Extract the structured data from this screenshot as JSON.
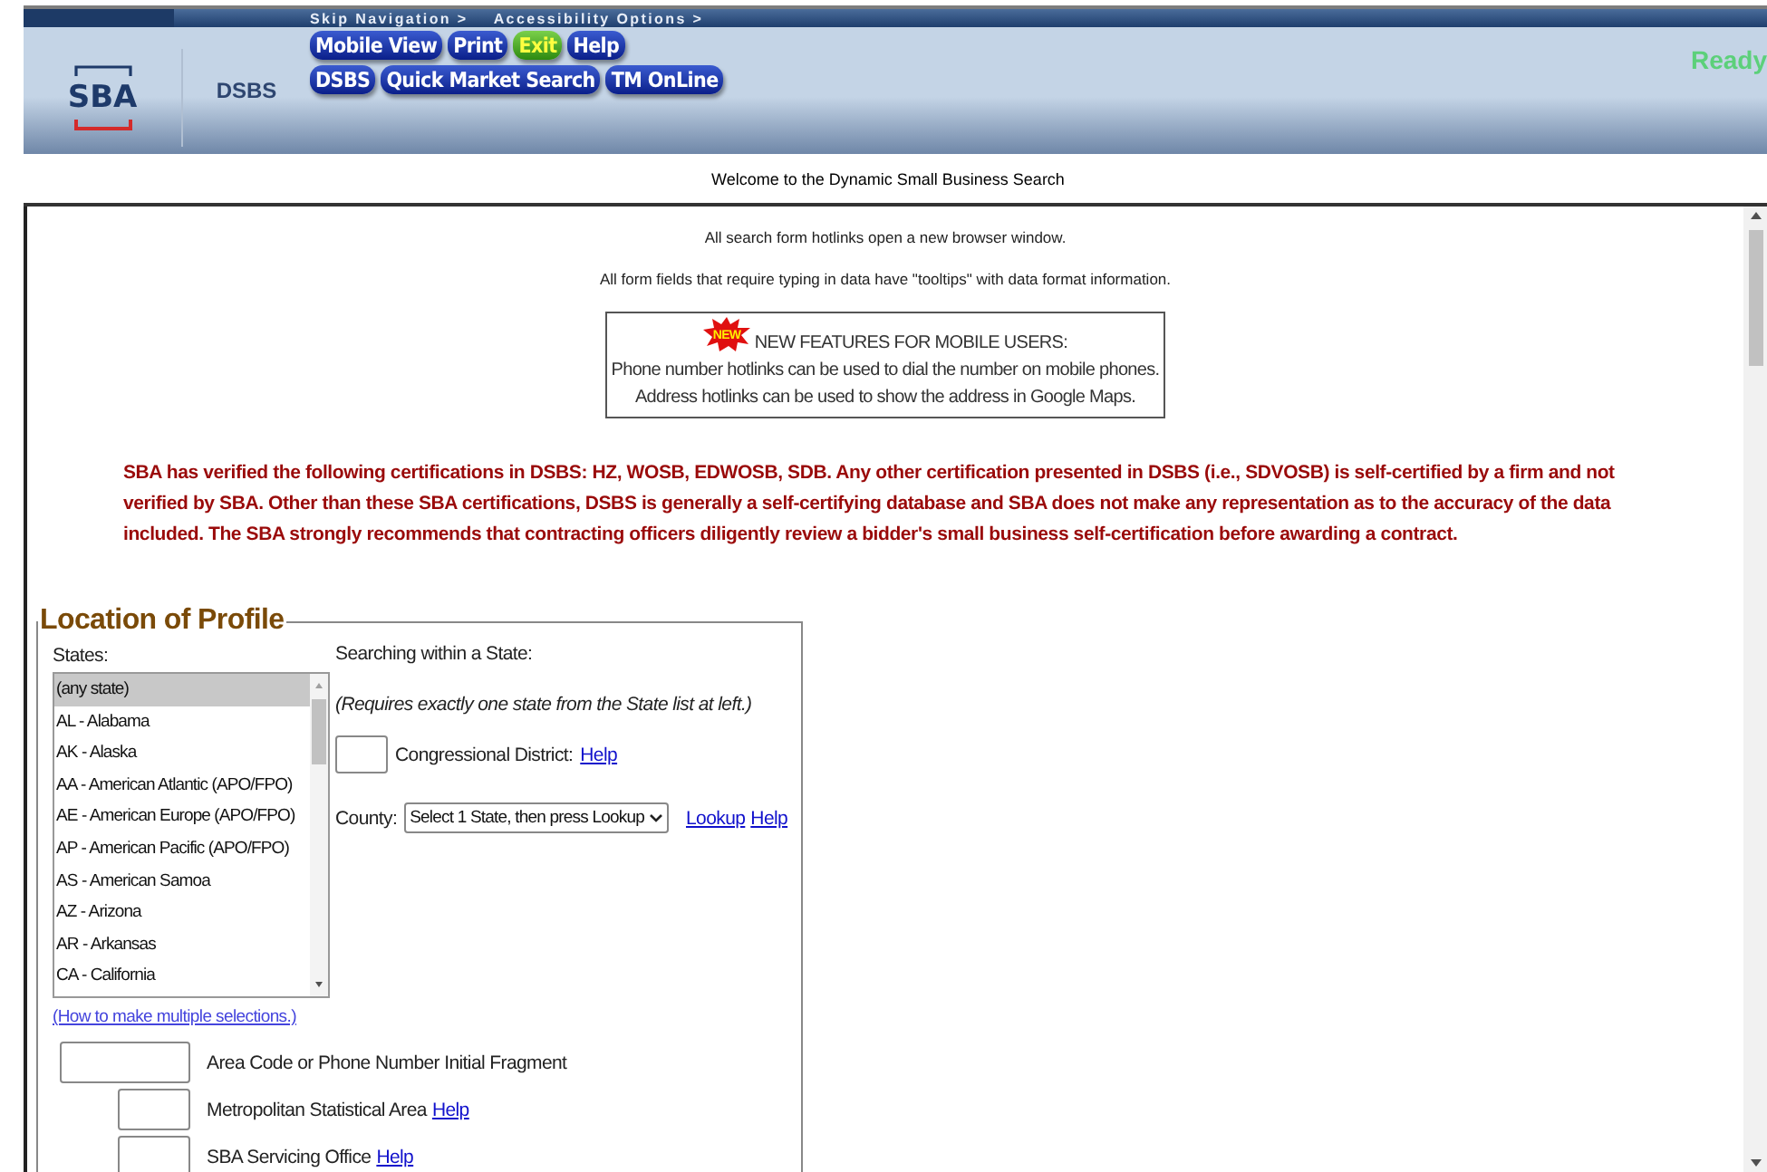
{
  "header": {
    "skip_links": [
      "Skip Navigation >",
      "Accessibility Options >"
    ],
    "logo": "SBA",
    "app_name": "DSBS",
    "nav_rows": [
      [
        {
          "label": "Mobile View",
          "kind": "normal"
        },
        {
          "label": "Print",
          "kind": "normal"
        },
        {
          "label": "Exit",
          "kind": "exit"
        },
        {
          "label": "Help",
          "kind": "normal"
        }
      ],
      [
        {
          "label": "DSBS",
          "kind": "normal"
        },
        {
          "label": "Quick Market Search",
          "kind": "normal"
        },
        {
          "label": "TM OnLine",
          "kind": "normal"
        }
      ]
    ],
    "status": "Ready"
  },
  "welcome": "Welcome to the Dynamic Small Business Search",
  "notes": [
    "All search form hotlinks open a new browser window.",
    "All form fields that require typing in data have \"tooltips\" with data format information."
  ],
  "notice": {
    "badge": "NEW",
    "title": "NEW FEATURES FOR MOBILE USERS:",
    "lines": [
      "Phone number hotlinks can be used to dial the number on mobile phones.",
      "Address hotlinks can be used to show the address in Google Maps."
    ]
  },
  "disclaimer": "SBA has verified the following certifications in DSBS: HZ, WOSB, EDWOSB, SDB. Any other certification presented in DSBS (i.e., SDVOSB) is self-certified by a firm and not verified by SBA. Other than these SBA certifications, DSBS is generally a self-certifying database and SBA does not make any representation as to the accuracy of the data included. The SBA strongly recommends that contracting officers diligently review a bidder's small business self-certification before awarding a contract.",
  "location": {
    "legend": "Location of Profile",
    "states_label": "States:",
    "states": [
      {
        "label": "(any state)",
        "selected": true
      },
      {
        "label": "AL - Alabama",
        "selected": false
      },
      {
        "label": "AK - Alaska",
        "selected": false
      },
      {
        "label": "AA - American Atlantic (APO/FPO)",
        "selected": false
      },
      {
        "label": "AE - American Europe (APO/FPO)",
        "selected": false
      },
      {
        "label": "AP - American Pacific (APO/FPO)",
        "selected": false
      },
      {
        "label": "AS - American Samoa",
        "selected": false
      },
      {
        "label": "AZ - Arizona",
        "selected": false
      },
      {
        "label": "AR - Arkansas",
        "selected": false
      },
      {
        "label": "CA - California",
        "selected": false
      }
    ],
    "multi_link": "(How to make multiple selections.)",
    "within_label": "Searching within a State:",
    "within_note": "(Requires exactly one state from the State list at left.)",
    "district_label": "Congressional District:",
    "district_help": "Help",
    "county_label": "County:",
    "county_select": "Select 1 State, then press Lookup",
    "county_lookup": "Lookup",
    "county_help": "Help",
    "fields": [
      {
        "label": "Area Code or Phone Number Initial Fragment",
        "kind": "wide"
      },
      {
        "label": "Metropolitan Statistical Area",
        "help": "Help",
        "kind": "narrow"
      },
      {
        "label": "SBA Servicing Office",
        "help": "Help",
        "kind": "narrow"
      }
    ]
  }
}
